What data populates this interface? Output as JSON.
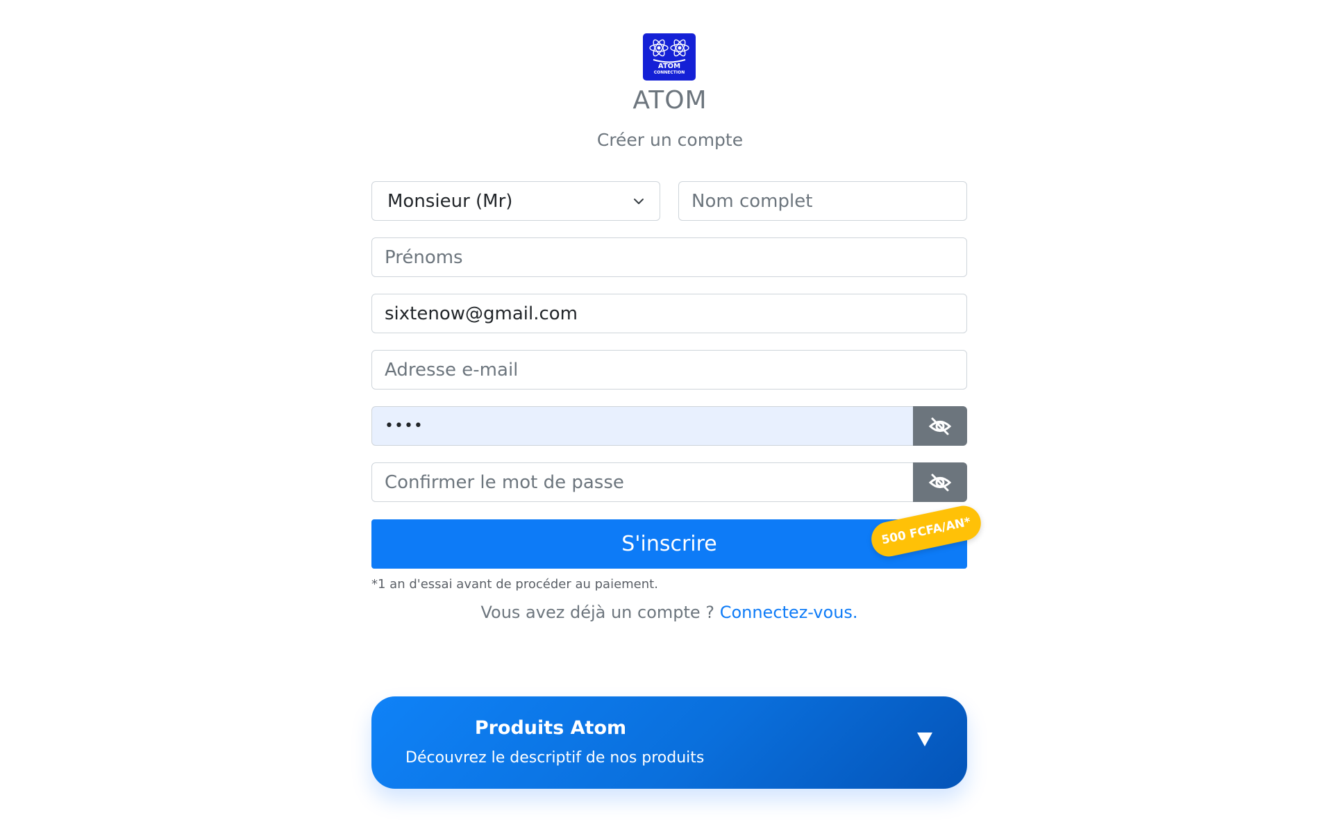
{
  "brand": {
    "logo_text": "ATOM",
    "logo_subtext": "CONNECTION",
    "name": "ATOM",
    "subtitle": "Créer un compte"
  },
  "form": {
    "civility": {
      "value": "Monsieur (Mr)",
      "icon": "chevron-down-icon"
    },
    "nom_complet": {
      "placeholder": "Nom complet",
      "value": ""
    },
    "prenoms": {
      "placeholder": "Prénoms",
      "value": ""
    },
    "phone_or_email": {
      "value": "sixtenow@gmail.com"
    },
    "email": {
      "placeholder": "Adresse e-mail",
      "value": ""
    },
    "password": {
      "value": "••••",
      "background": "#e8f0fe",
      "toggle_icon": "eye-slash-icon"
    },
    "confirm_password": {
      "placeholder": "Confirmer le mot de passe",
      "value": "",
      "toggle_icon": "eye-slash-icon"
    },
    "submit_label": "S'inscrire",
    "price_badge": "500 FCFA/AN*",
    "trial_note": "*1 an d'essai avant de procéder au paiement.",
    "login_prompt": "Vous avez déjà un compte ?",
    "login_link": "Connectez-vous."
  },
  "products_panel": {
    "title": "Produits Atom",
    "description": "Découvrez le descriptif de nos produits",
    "toggle_icon": "triangle-down-icon"
  },
  "colors": {
    "primary": "#0d7bf7",
    "secondary": "#6c757d",
    "badge": "#ffc107",
    "logo_bg": "#1420d6",
    "autofill_bg": "#e8f0fe"
  }
}
